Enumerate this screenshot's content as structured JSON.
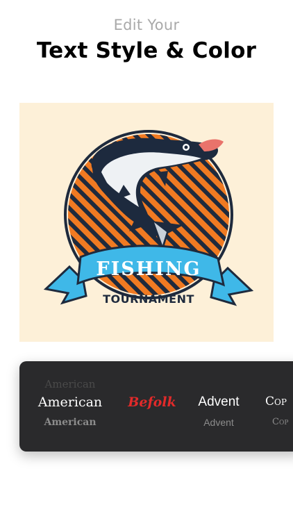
{
  "header": {
    "subtitle": "Edit Your",
    "title": "Text Style & Color"
  },
  "logo": {
    "banner_text": "FISHING",
    "tagline": "TOURNAMENT",
    "colors": {
      "background": "#fdf0d8",
      "circle_stripe_orange": "#f07a22",
      "circle_stripe_dark": "#1e2a3d",
      "ribbon": "#3fb8e8",
      "ribbon_dark": "#2388b8",
      "fish_dark": "#1d2a3e",
      "fish_light": "#eef1f4"
    }
  },
  "font_panel": {
    "options": [
      {
        "top": "American",
        "main": "American",
        "bottom": "American"
      },
      {
        "main": "Befolk"
      },
      {
        "main": "Advent",
        "bottom": "Advent"
      },
      {
        "main": "Cop",
        "bottom": "Cop"
      }
    ]
  }
}
